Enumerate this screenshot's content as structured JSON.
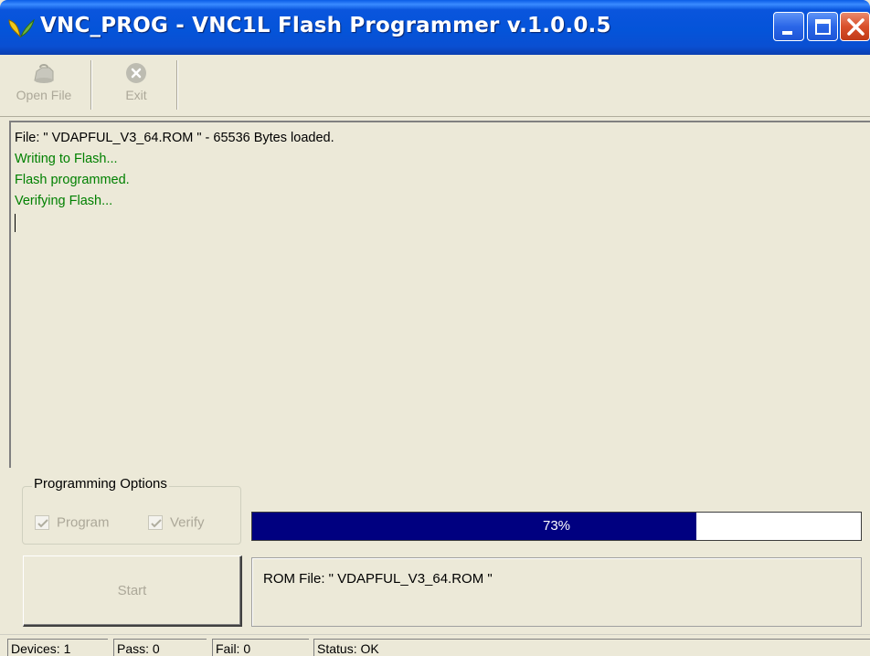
{
  "window": {
    "title": "VNC_PROG - VNC1L Flash Programmer v.1.0.0.5",
    "title_icon": "vnc-leaf-icon",
    "controls": [
      "minimize-icon",
      "maximize-icon",
      "close-icon"
    ]
  },
  "toolbar": {
    "open_label": "Open File",
    "open_icon": "open-folder-icon",
    "exit_label": "Exit",
    "exit_icon": "exit-icon"
  },
  "log": {
    "lines": [
      {
        "text": "File: \" VDAPFUL_V3_64.ROM \" - 65536 Bytes loaded.",
        "color": "#000000"
      },
      {
        "text": "Writing to Flash...",
        "color": "#008000"
      },
      {
        "text": "Flash programmed.",
        "color": "#008000"
      },
      {
        "text": "Verifying Flash...",
        "color": "#008000"
      }
    ]
  },
  "options": {
    "legend": "Programming Options",
    "program_label": "Program",
    "program_checked": true,
    "verify_label": "Verify",
    "verify_checked": true
  },
  "progress": {
    "value": 0.73,
    "label": "73%",
    "fill_color": "#000080"
  },
  "start_label": "Start",
  "rom_file_text": "ROM File: \" VDAPFUL_V3_64.ROM \"",
  "statusbar": {
    "devices": "Devices: 1",
    "pass": "Pass: 0",
    "fail": "Fail: 0",
    "status": "Status: OK"
  }
}
